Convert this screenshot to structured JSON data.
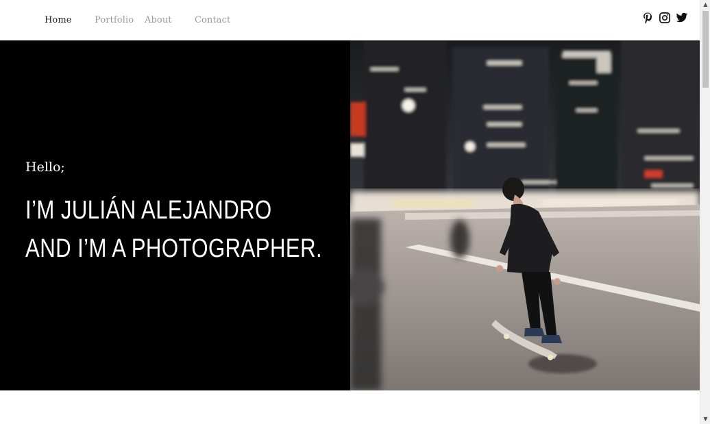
{
  "nav": {
    "items": [
      {
        "label": "Home",
        "active": true
      },
      {
        "label": "Portfolio",
        "active": false
      },
      {
        "label": "About",
        "active": false
      },
      {
        "label": "Contact",
        "active": false
      }
    ]
  },
  "social": {
    "icons": [
      "pinterest-icon",
      "instagram-icon",
      "twitter-icon"
    ]
  },
  "hero": {
    "greeting": "Hello;",
    "headline_line1": "I’M JULIÁN ALEJANDRO",
    "headline_line2": "AND I’M A PHOTOGRAPHER.",
    "image_subject": "skateboarder-at-night-city-street"
  },
  "colors": {
    "hero_background": "#000000",
    "nav_active": "#222222",
    "nav_inactive": "#9a9a9a",
    "text_on_dark": "#ffffff"
  }
}
